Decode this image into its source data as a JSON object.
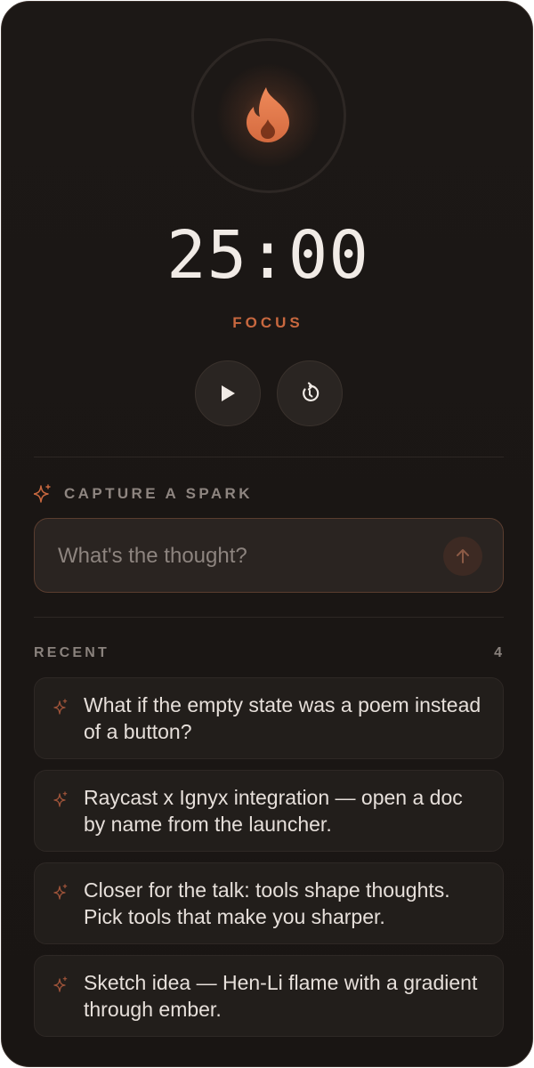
{
  "timer": {
    "time": "25:00",
    "mode": "FOCUS",
    "icon": "flame-icon"
  },
  "controls": {
    "play_icon": "play-icon",
    "reset_icon": "reset-icon"
  },
  "capture": {
    "title": "CAPTURE A SPARK",
    "placeholder": "What's the thought?",
    "value": "",
    "send_icon": "arrow-up-icon"
  },
  "recent": {
    "title": "RECENT",
    "count": "4",
    "items": [
      {
        "text": "What if the empty state was a poem instead of a button?"
      },
      {
        "text": "Raycast x Ignyx integration — open a doc by name from the launcher."
      },
      {
        "text": "Closer for the talk: tools shape thoughts. Pick tools that make you sharper."
      },
      {
        "text": "Sketch idea — Hen-Li flame with a gradient through ember."
      }
    ]
  },
  "colors": {
    "background": "#1a1614",
    "accent": "#c8683f",
    "text": "#e6dfda",
    "muted": "#8a827d"
  }
}
